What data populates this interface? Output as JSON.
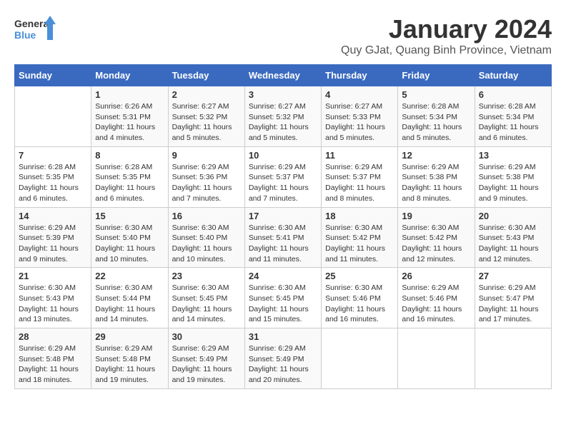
{
  "header": {
    "logo_general": "General",
    "logo_blue": "Blue",
    "month_year": "January 2024",
    "location": "Quy GJat, Quang Binh Province, Vietnam"
  },
  "days_of_week": [
    "Sunday",
    "Monday",
    "Tuesday",
    "Wednesday",
    "Thursday",
    "Friday",
    "Saturday"
  ],
  "weeks": [
    [
      {
        "day": "",
        "sunrise": "",
        "sunset": "",
        "daylight": ""
      },
      {
        "day": "1",
        "sunrise": "Sunrise: 6:26 AM",
        "sunset": "Sunset: 5:31 PM",
        "daylight": "Daylight: 11 hours and 4 minutes."
      },
      {
        "day": "2",
        "sunrise": "Sunrise: 6:27 AM",
        "sunset": "Sunset: 5:32 PM",
        "daylight": "Daylight: 11 hours and 5 minutes."
      },
      {
        "day": "3",
        "sunrise": "Sunrise: 6:27 AM",
        "sunset": "Sunset: 5:32 PM",
        "daylight": "Daylight: 11 hours and 5 minutes."
      },
      {
        "day": "4",
        "sunrise": "Sunrise: 6:27 AM",
        "sunset": "Sunset: 5:33 PM",
        "daylight": "Daylight: 11 hours and 5 minutes."
      },
      {
        "day": "5",
        "sunrise": "Sunrise: 6:28 AM",
        "sunset": "Sunset: 5:34 PM",
        "daylight": "Daylight: 11 hours and 5 minutes."
      },
      {
        "day": "6",
        "sunrise": "Sunrise: 6:28 AM",
        "sunset": "Sunset: 5:34 PM",
        "daylight": "Daylight: 11 hours and 6 minutes."
      }
    ],
    [
      {
        "day": "7",
        "sunrise": "Sunrise: 6:28 AM",
        "sunset": "Sunset: 5:35 PM",
        "daylight": "Daylight: 11 hours and 6 minutes."
      },
      {
        "day": "8",
        "sunrise": "Sunrise: 6:28 AM",
        "sunset": "Sunset: 5:35 PM",
        "daylight": "Daylight: 11 hours and 6 minutes."
      },
      {
        "day": "9",
        "sunrise": "Sunrise: 6:29 AM",
        "sunset": "Sunset: 5:36 PM",
        "daylight": "Daylight: 11 hours and 7 minutes."
      },
      {
        "day": "10",
        "sunrise": "Sunrise: 6:29 AM",
        "sunset": "Sunset: 5:37 PM",
        "daylight": "Daylight: 11 hours and 7 minutes."
      },
      {
        "day": "11",
        "sunrise": "Sunrise: 6:29 AM",
        "sunset": "Sunset: 5:37 PM",
        "daylight": "Daylight: 11 hours and 8 minutes."
      },
      {
        "day": "12",
        "sunrise": "Sunrise: 6:29 AM",
        "sunset": "Sunset: 5:38 PM",
        "daylight": "Daylight: 11 hours and 8 minutes."
      },
      {
        "day": "13",
        "sunrise": "Sunrise: 6:29 AM",
        "sunset": "Sunset: 5:38 PM",
        "daylight": "Daylight: 11 hours and 9 minutes."
      }
    ],
    [
      {
        "day": "14",
        "sunrise": "Sunrise: 6:29 AM",
        "sunset": "Sunset: 5:39 PM",
        "daylight": "Daylight: 11 hours and 9 minutes."
      },
      {
        "day": "15",
        "sunrise": "Sunrise: 6:30 AM",
        "sunset": "Sunset: 5:40 PM",
        "daylight": "Daylight: 11 hours and 10 minutes."
      },
      {
        "day": "16",
        "sunrise": "Sunrise: 6:30 AM",
        "sunset": "Sunset: 5:40 PM",
        "daylight": "Daylight: 11 hours and 10 minutes."
      },
      {
        "day": "17",
        "sunrise": "Sunrise: 6:30 AM",
        "sunset": "Sunset: 5:41 PM",
        "daylight": "Daylight: 11 hours and 11 minutes."
      },
      {
        "day": "18",
        "sunrise": "Sunrise: 6:30 AM",
        "sunset": "Sunset: 5:42 PM",
        "daylight": "Daylight: 11 hours and 11 minutes."
      },
      {
        "day": "19",
        "sunrise": "Sunrise: 6:30 AM",
        "sunset": "Sunset: 5:42 PM",
        "daylight": "Daylight: 11 hours and 12 minutes."
      },
      {
        "day": "20",
        "sunrise": "Sunrise: 6:30 AM",
        "sunset": "Sunset: 5:43 PM",
        "daylight": "Daylight: 11 hours and 12 minutes."
      }
    ],
    [
      {
        "day": "21",
        "sunrise": "Sunrise: 6:30 AM",
        "sunset": "Sunset: 5:43 PM",
        "daylight": "Daylight: 11 hours and 13 minutes."
      },
      {
        "day": "22",
        "sunrise": "Sunrise: 6:30 AM",
        "sunset": "Sunset: 5:44 PM",
        "daylight": "Daylight: 11 hours and 14 minutes."
      },
      {
        "day": "23",
        "sunrise": "Sunrise: 6:30 AM",
        "sunset": "Sunset: 5:45 PM",
        "daylight": "Daylight: 11 hours and 14 minutes."
      },
      {
        "day": "24",
        "sunrise": "Sunrise: 6:30 AM",
        "sunset": "Sunset: 5:45 PM",
        "daylight": "Daylight: 11 hours and 15 minutes."
      },
      {
        "day": "25",
        "sunrise": "Sunrise: 6:30 AM",
        "sunset": "Sunset: 5:46 PM",
        "daylight": "Daylight: 11 hours and 16 minutes."
      },
      {
        "day": "26",
        "sunrise": "Sunrise: 6:29 AM",
        "sunset": "Sunset: 5:46 PM",
        "daylight": "Daylight: 11 hours and 16 minutes."
      },
      {
        "day": "27",
        "sunrise": "Sunrise: 6:29 AM",
        "sunset": "Sunset: 5:47 PM",
        "daylight": "Daylight: 11 hours and 17 minutes."
      }
    ],
    [
      {
        "day": "28",
        "sunrise": "Sunrise: 6:29 AM",
        "sunset": "Sunset: 5:48 PM",
        "daylight": "Daylight: 11 hours and 18 minutes."
      },
      {
        "day": "29",
        "sunrise": "Sunrise: 6:29 AM",
        "sunset": "Sunset: 5:48 PM",
        "daylight": "Daylight: 11 hours and 19 minutes."
      },
      {
        "day": "30",
        "sunrise": "Sunrise: 6:29 AM",
        "sunset": "Sunset: 5:49 PM",
        "daylight": "Daylight: 11 hours and 19 minutes."
      },
      {
        "day": "31",
        "sunrise": "Sunrise: 6:29 AM",
        "sunset": "Sunset: 5:49 PM",
        "daylight": "Daylight: 11 hours and 20 minutes."
      },
      {
        "day": "",
        "sunrise": "",
        "sunset": "",
        "daylight": ""
      },
      {
        "day": "",
        "sunrise": "",
        "sunset": "",
        "daylight": ""
      },
      {
        "day": "",
        "sunrise": "",
        "sunset": "",
        "daylight": ""
      }
    ]
  ]
}
